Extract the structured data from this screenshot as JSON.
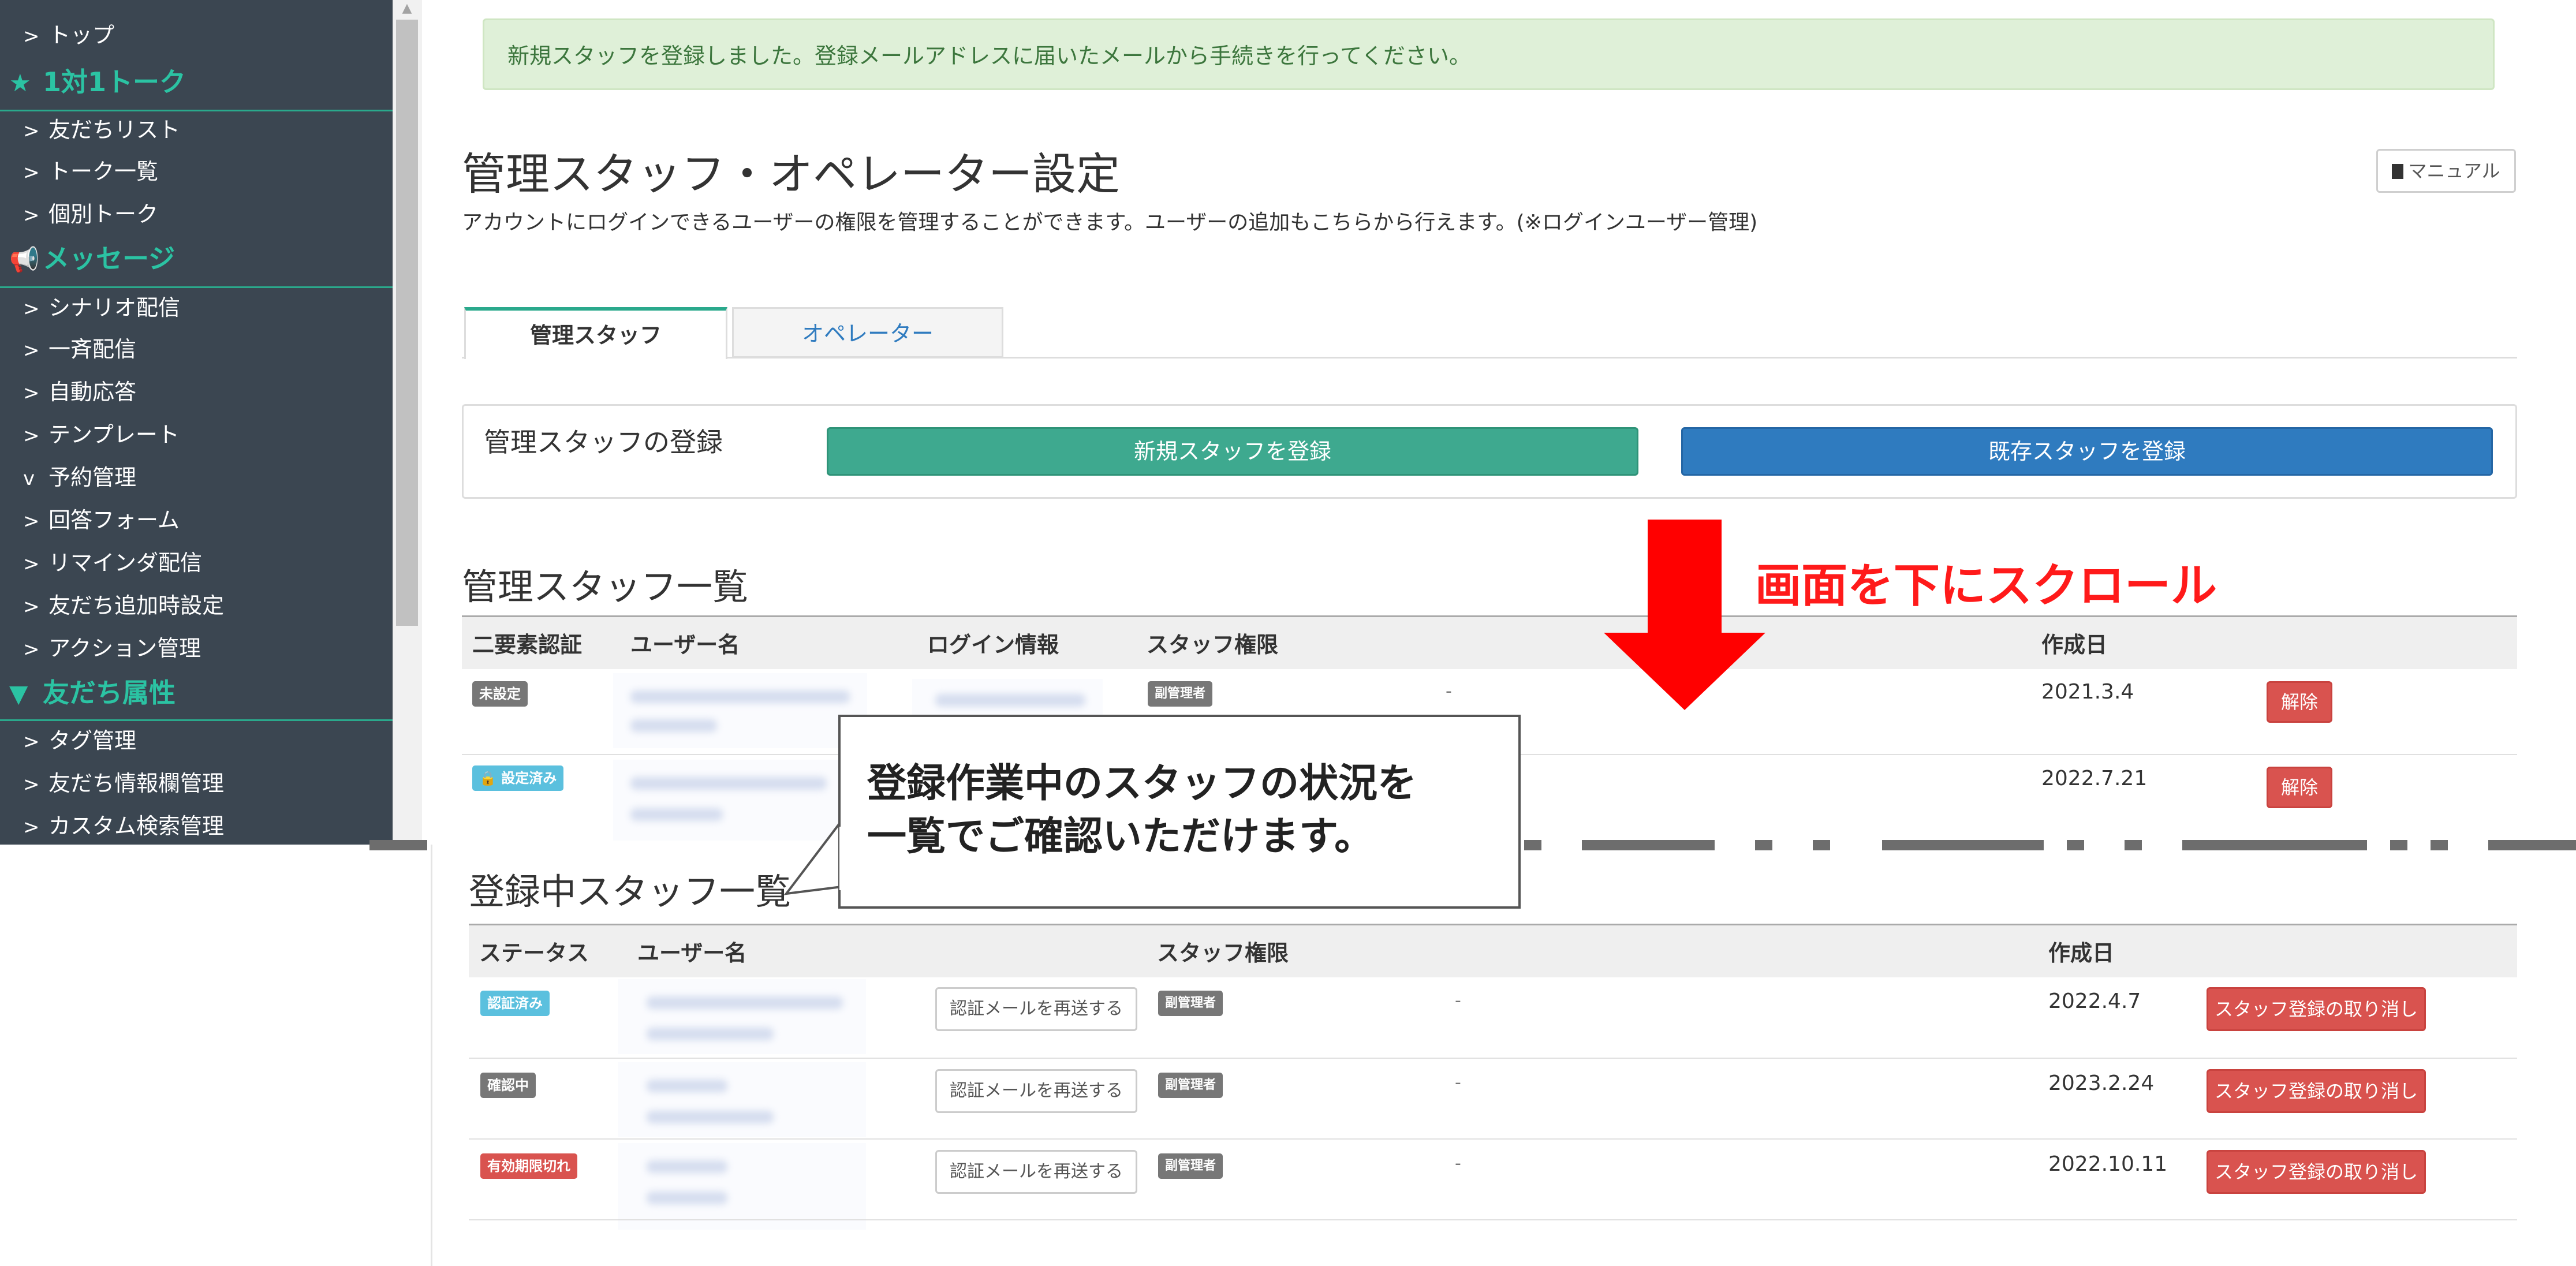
{
  "sidebar": {
    "items": [
      {
        "type": "link",
        "label": "トップ",
        "chevron": ">"
      },
      {
        "type": "heading",
        "label": "1対1トーク",
        "icon": "star-icon"
      },
      {
        "type": "link",
        "label": "友だちリスト",
        "chevron": ">"
      },
      {
        "type": "link",
        "label": "トーク一覧",
        "chevron": ">"
      },
      {
        "type": "link",
        "label": "個別トーク",
        "chevron": ">"
      },
      {
        "type": "heading",
        "label": "メッセージ",
        "icon": "megaphone-icon"
      },
      {
        "type": "link",
        "label": "シナリオ配信",
        "chevron": ">"
      },
      {
        "type": "link",
        "label": "一斉配信",
        "chevron": ">"
      },
      {
        "type": "link",
        "label": "自動応答",
        "chevron": ">"
      },
      {
        "type": "link",
        "label": "テンプレート",
        "chevron": ">"
      },
      {
        "type": "link",
        "label": "予約管理",
        "chevron": "v"
      },
      {
        "type": "link",
        "label": "回答フォーム",
        "chevron": ">"
      },
      {
        "type": "link",
        "label": "リマインダ配信",
        "chevron": ">"
      },
      {
        "type": "link",
        "label": "友だち追加時設定",
        "chevron": ">"
      },
      {
        "type": "link",
        "label": "アクション管理",
        "chevron": ">"
      },
      {
        "type": "heading",
        "label": "友だち属性",
        "icon": "filter-icon"
      },
      {
        "type": "link",
        "label": "タグ管理",
        "chevron": ">"
      },
      {
        "type": "link",
        "label": "友だち情報欄管理",
        "chevron": ">"
      },
      {
        "type": "link",
        "label": "カスタム検索管理",
        "chevron": ">"
      }
    ]
  },
  "alert": {
    "text": "新規スタッフを登録しました。登録メールアドレスに届いたメールから手続きを行ってください。"
  },
  "header": {
    "title": "管理スタッフ・オペレーター設定",
    "description": "アカウントにログインできるユーザーの権限を管理することができます。ユーザーの追加もこちらから行えます。(※ログインユーザー管理)",
    "manual_label": "マニュアル"
  },
  "tabs": [
    {
      "label": "管理スタッフ",
      "active": true
    },
    {
      "label": "オペレーター",
      "active": false
    }
  ],
  "register": {
    "label": "管理スタッフの登録",
    "new_button": "新規スタッフを登録",
    "existing_button": "既存スタッフを登録"
  },
  "staff_list": {
    "title": "管理スタッフ一覧",
    "columns": [
      "二要素認証",
      "ユーザー名",
      "ログイン情報",
      "スタッフ権限",
      "作成日"
    ],
    "rows": [
      {
        "two_factor": "未設定",
        "role": "副管理者",
        "note": "-",
        "created": "2021.3.4",
        "action": "解除"
      },
      {
        "two_factor": "設定済み",
        "created": "2022.7.21",
        "action": "解除"
      }
    ]
  },
  "pending_list": {
    "title": "登録中スタッフ一覧",
    "columns": [
      "ステータス",
      "ユーザー名",
      "スタッフ権限",
      "作成日"
    ],
    "rows": [
      {
        "status": "認証済み",
        "resend": "認証メールを再送する",
        "role": "副管理者",
        "note": "-",
        "created": "2022.4.7",
        "action": "スタッフ登録の取り消し"
      },
      {
        "status": "確認中",
        "resend": "認証メールを再送する",
        "role": "副管理者",
        "note": "-",
        "created": "2023.2.24",
        "action": "スタッフ登録の取り消し"
      },
      {
        "status": "有効期限切れ",
        "resend": "認証メールを再送する",
        "role": "副管理者",
        "note": "-",
        "created": "2022.10.11",
        "action": "スタッフ登録の取り消し"
      }
    ]
  },
  "annotations": {
    "scroll_note": "画面を下にスクロール",
    "callout_line1": "登録作業中のスタッフの状況を",
    "callout_line2": "一覧でご確認いただけます。"
  },
  "colors": {
    "sidebar_bg": "#3b4651",
    "sidebar_accent": "#2bc3a3",
    "primary_green": "#3ea98f",
    "primary_blue": "#2f7bbf",
    "danger": "#d9534f",
    "alert_bg": "#dff0d8",
    "annotation_red": "#ff1a1a"
  }
}
